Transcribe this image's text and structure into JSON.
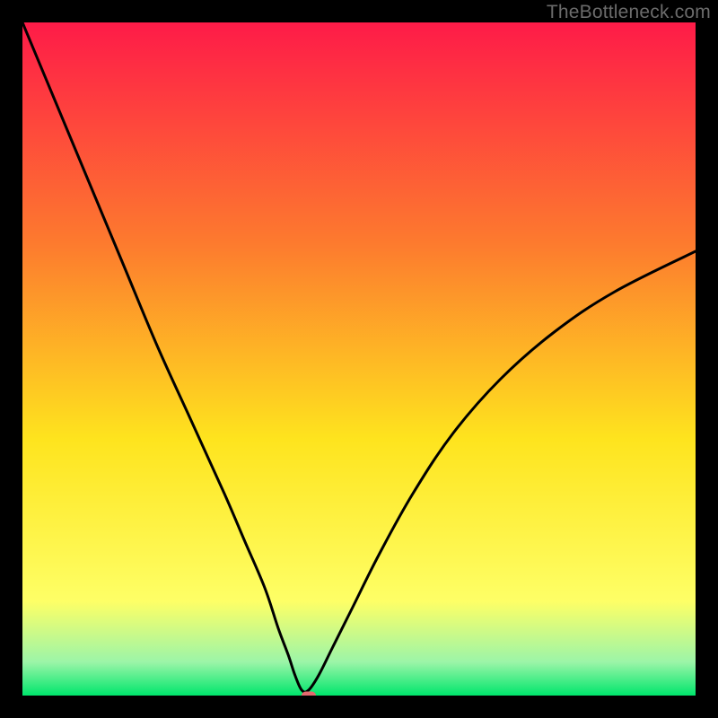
{
  "watermark": "TheBottleneck.com",
  "colors": {
    "frame": "#000000",
    "curve": "#000000",
    "marker": "#e46a6f",
    "gradient_top": "#fe1b48",
    "gradient_mid1": "#fd7b2e",
    "gradient_mid2": "#fee41e",
    "gradient_yellow": "#feff66",
    "gradient_mint": "#9cf5a8",
    "gradient_green": "#00e66c"
  },
  "chart_data": {
    "type": "line",
    "title": "",
    "xlabel": "",
    "ylabel": "",
    "xlim": [
      0,
      100
    ],
    "ylim": [
      0,
      100
    ],
    "grid": false,
    "legend": false,
    "notch_x": 41.5,
    "marker": {
      "x": 42.5,
      "y": 0
    },
    "series": [
      {
        "name": "bottleneck-curve",
        "x": [
          0,
          5,
          10,
          15,
          20,
          25,
          30,
          33,
          36,
          38,
          39.5,
          40.5,
          41.5,
          42.5,
          44,
          46,
          49,
          53,
          58,
          64,
          71,
          79,
          88,
          100
        ],
        "y": [
          100,
          88,
          76,
          64,
          52,
          41,
          30,
          23,
          16,
          10,
          6,
          3,
          0.8,
          0.8,
          3,
          7,
          13,
          21,
          30,
          39,
          47,
          54,
          60,
          66
        ]
      }
    ]
  }
}
